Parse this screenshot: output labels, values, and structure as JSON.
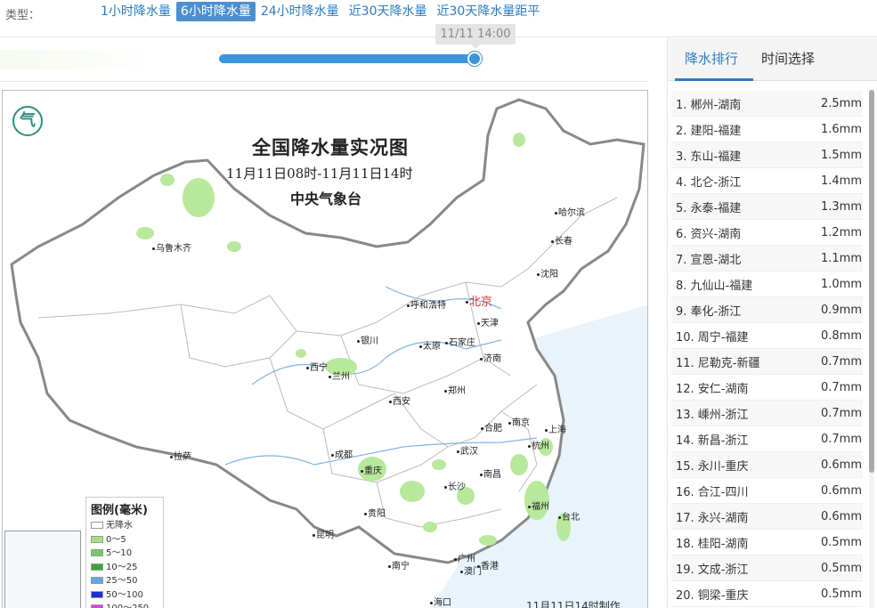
{
  "type_bar": {
    "label": "类型：",
    "tabs": [
      "1小时降水量",
      "6小时降水量",
      "24小时降水量",
      "近30天降水量",
      "近30天降水量距平"
    ],
    "active_index": 1
  },
  "time_slider": {
    "time_label": "11/11 14:00",
    "position_fraction": 0.97
  },
  "map": {
    "title": "全国降水量实况图",
    "subtitle": "11月11日08时-11月11日14时",
    "organization": "中央气象台",
    "logo_icon": "cma-logo-icon",
    "produced_note": "11月11日14时制作",
    "cities": [
      {
        "name": "哈尔滨"
      },
      {
        "name": "长春"
      },
      {
        "name": "沈阳"
      },
      {
        "name": "乌鲁木齐"
      },
      {
        "name": "呼和浩特"
      },
      {
        "name": "北京"
      },
      {
        "name": "天津"
      },
      {
        "name": "石家庄"
      },
      {
        "name": "太原"
      },
      {
        "name": "银川"
      },
      {
        "name": "济南"
      },
      {
        "name": "西宁"
      },
      {
        "name": "兰州"
      },
      {
        "name": "郑州"
      },
      {
        "name": "西安"
      },
      {
        "name": "合肥"
      },
      {
        "name": "南京"
      },
      {
        "name": "上海"
      },
      {
        "name": "拉萨"
      },
      {
        "name": "成都"
      },
      {
        "name": "武汉"
      },
      {
        "name": "杭州"
      },
      {
        "name": "重庆"
      },
      {
        "name": "南昌"
      },
      {
        "name": "长沙"
      },
      {
        "name": "贵阳"
      },
      {
        "name": "福州"
      },
      {
        "name": "台北"
      },
      {
        "name": "昆明"
      },
      {
        "name": "广州"
      },
      {
        "name": "南宁"
      },
      {
        "name": "澳门"
      },
      {
        "name": "香港"
      },
      {
        "name": "海口"
      }
    ],
    "legend": {
      "title": "图例(毫米)",
      "items": [
        {
          "label": "无降水",
          "color": "#ffffff"
        },
        {
          "label": "0～5",
          "color": "#a6e07e"
        },
        {
          "label": "5～10",
          "color": "#6ccf5e"
        },
        {
          "label": "10～25",
          "color": "#3da33a"
        },
        {
          "label": "25～50",
          "color": "#60a8e8"
        },
        {
          "label": "50～100",
          "color": "#1a2fd0"
        },
        {
          "label": "100～250",
          "color": "#e13fe6"
        }
      ]
    }
  },
  "panel": {
    "tabs": [
      "降水排行",
      "时间选择"
    ],
    "active_tab": 0,
    "ranking": [
      {
        "label": "1. 郴州-湖南",
        "value": "2.5mm"
      },
      {
        "label": "2. 建阳-福建",
        "value": "1.6mm"
      },
      {
        "label": "3. 东山-福建",
        "value": "1.5mm"
      },
      {
        "label": "4. 北仑-浙江",
        "value": "1.4mm"
      },
      {
        "label": "5. 永泰-福建",
        "value": "1.3mm"
      },
      {
        "label": "6. 资兴-湖南",
        "value": "1.2mm"
      },
      {
        "label": "7. 宣恩-湖北",
        "value": "1.1mm"
      },
      {
        "label": "8. 九仙山-福建",
        "value": "1.0mm"
      },
      {
        "label": "9. 奉化-浙江",
        "value": "0.9mm"
      },
      {
        "label": "10. 周宁-福建",
        "value": "0.8mm"
      },
      {
        "label": "11. 尼勒克-新疆",
        "value": "0.7mm"
      },
      {
        "label": "12. 安仁-湖南",
        "value": "0.7mm"
      },
      {
        "label": "13. 嵊州-浙江",
        "value": "0.7mm"
      },
      {
        "label": "14. 新昌-浙江",
        "value": "0.7mm"
      },
      {
        "label": "15. 永川-重庆",
        "value": "0.6mm"
      },
      {
        "label": "16. 合江-四川",
        "value": "0.6mm"
      },
      {
        "label": "17. 永兴-湖南",
        "value": "0.6mm"
      },
      {
        "label": "18. 桂阳-湖南",
        "value": "0.5mm"
      },
      {
        "label": "19. 文成-浙江",
        "value": "0.5mm"
      },
      {
        "label": "20. 铜梁-重庆",
        "value": "0.5mm"
      }
    ]
  }
}
